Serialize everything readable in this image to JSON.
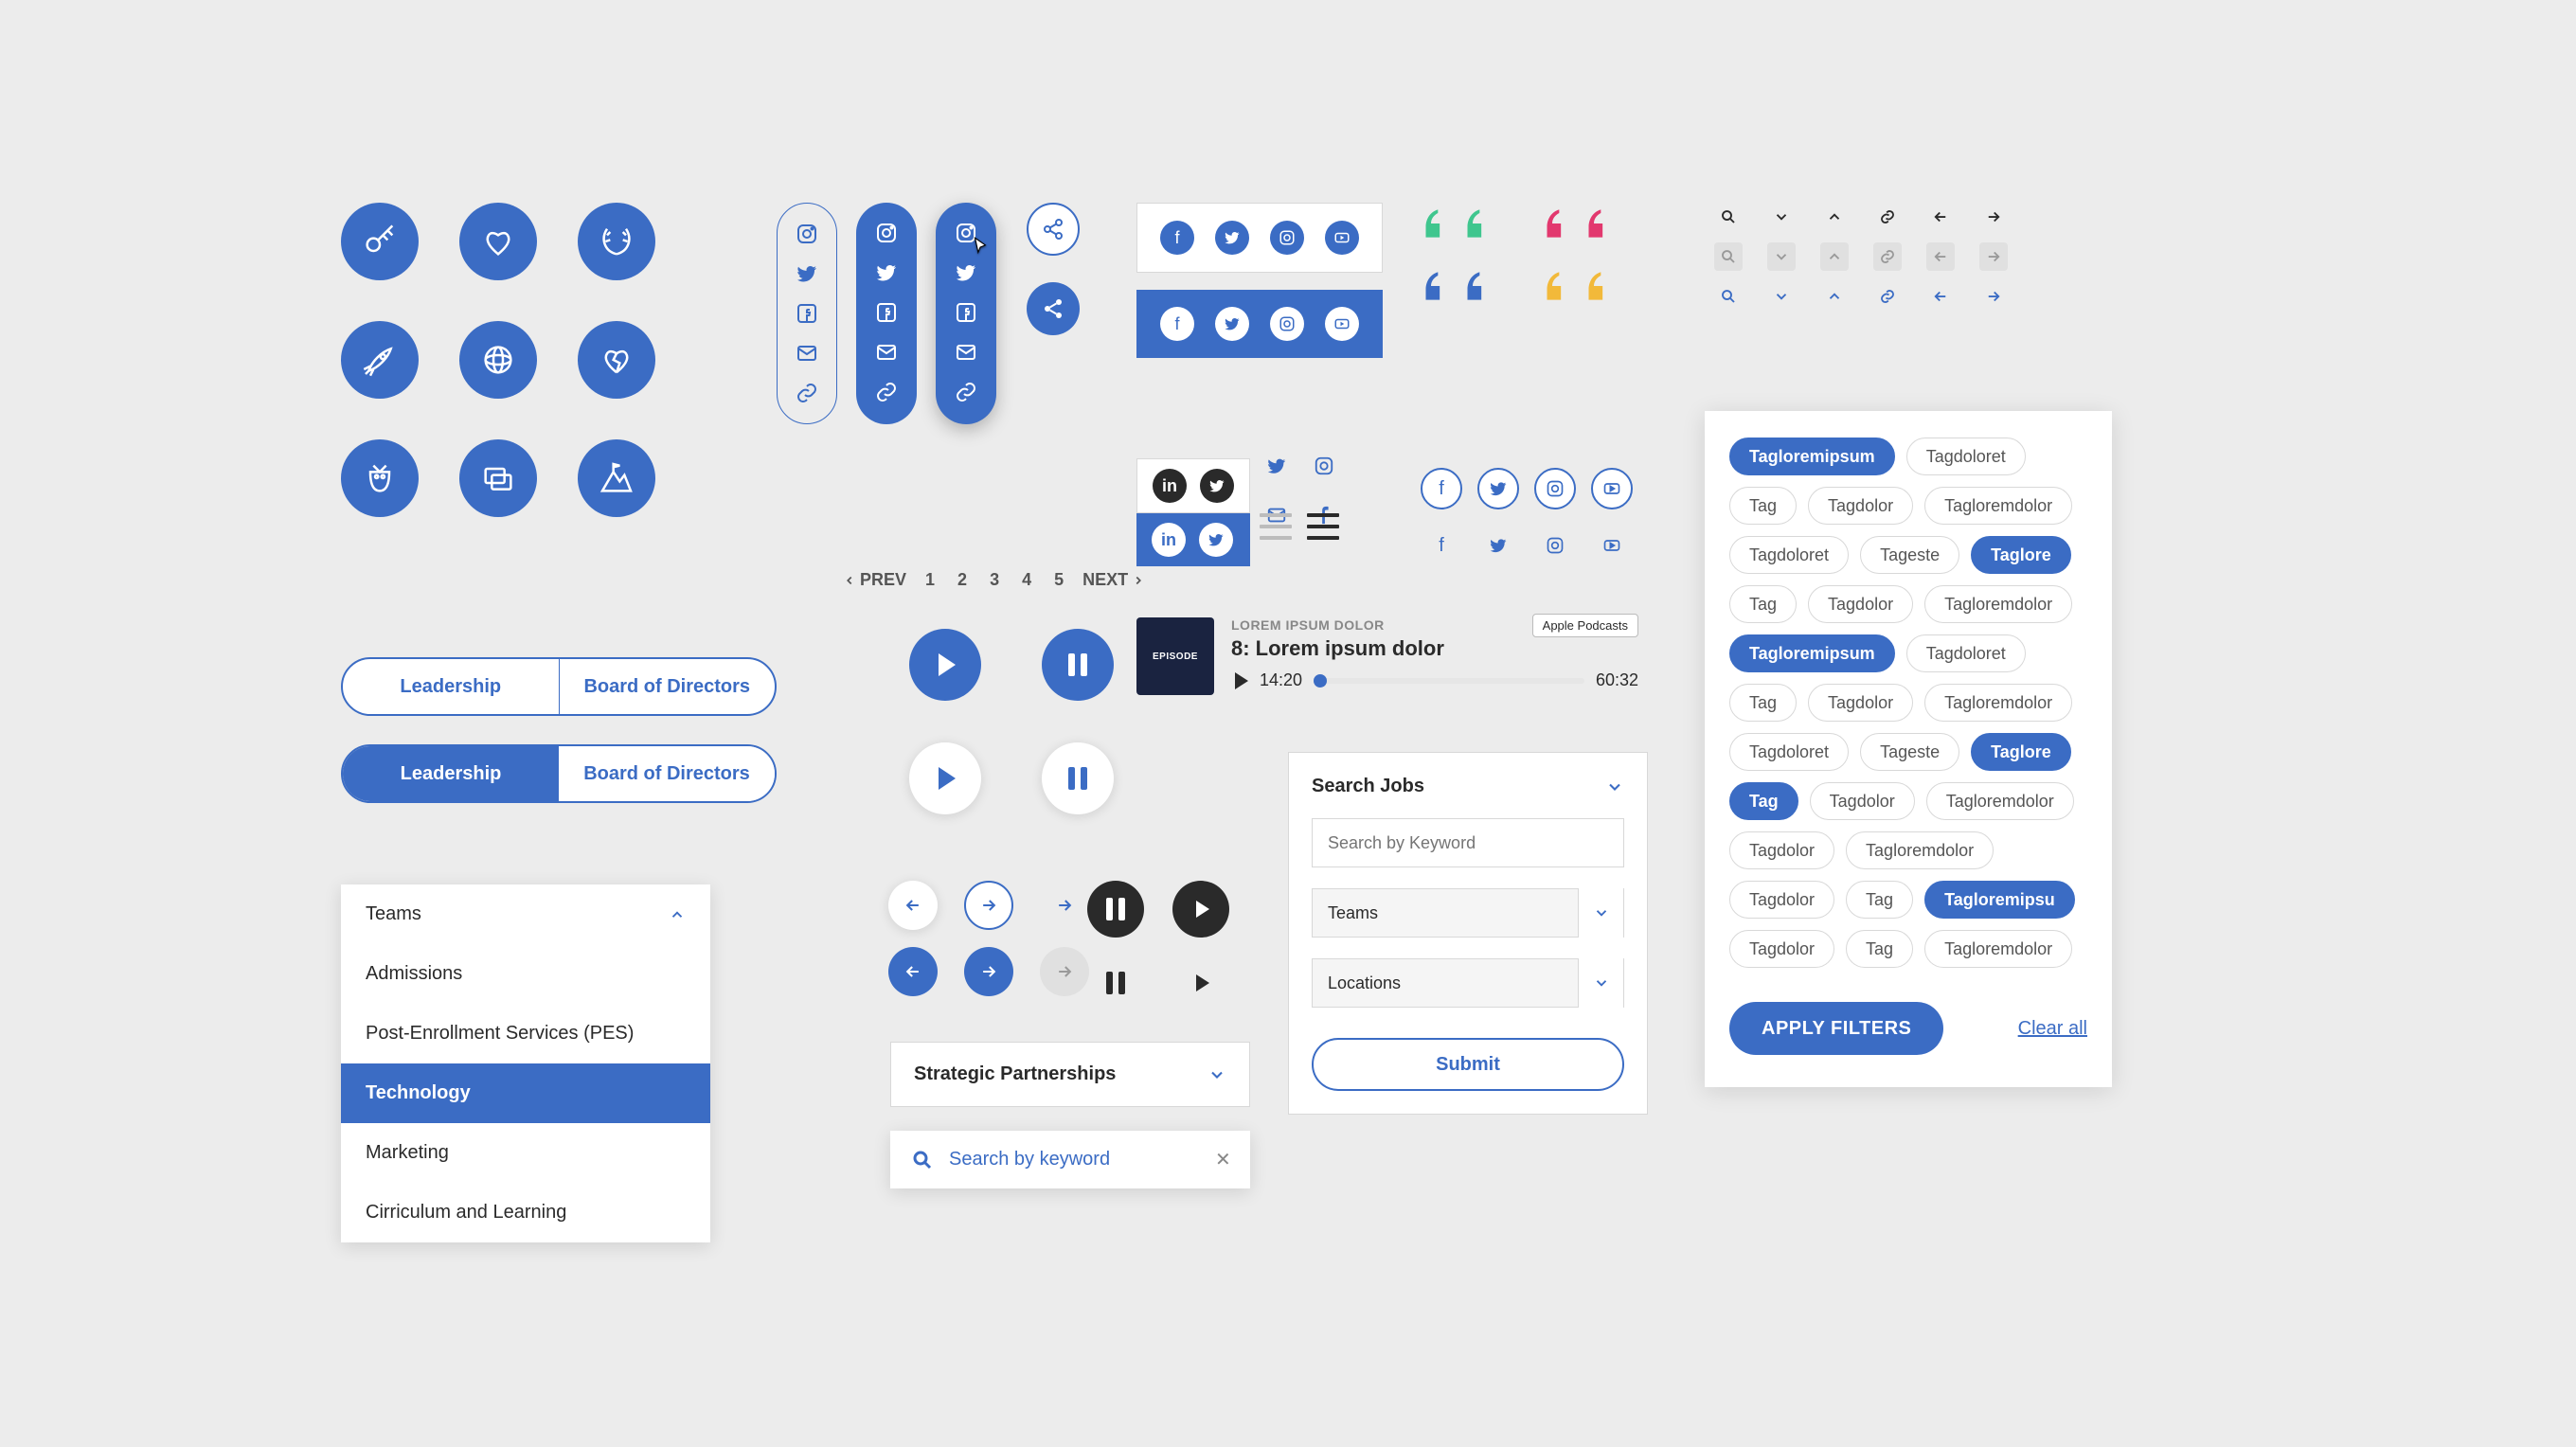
{
  "colors": {
    "primary": "#3b6cc4",
    "green": "#3fc68e",
    "pink": "#e2386e",
    "yellow": "#f2b93a"
  },
  "feature_icons": [
    "key",
    "heart-hands",
    "laurel",
    "rocket",
    "globe",
    "broken-heart",
    "owl",
    "chat-layers",
    "mountain-flag"
  ],
  "social_pills": {
    "variants": [
      "outline",
      "solid",
      "shadow"
    ],
    "items": [
      "instagram",
      "twitter",
      "facebook",
      "mail",
      "link"
    ]
  },
  "share_buttons": [
    "share-outline",
    "share-solid"
  ],
  "social_bars": {
    "items": [
      "facebook",
      "twitter",
      "instagram",
      "youtube"
    ]
  },
  "linkedin_twitter_block": {
    "rows": [
      {
        "style": "outline",
        "items": [
          "linkedin",
          "twitter"
        ]
      },
      {
        "style": "filled",
        "items": [
          "linkedin",
          "twitter"
        ]
      }
    ]
  },
  "hamburger_variants": [
    "grey",
    "dark"
  ],
  "social_small_grid": {
    "rows": [
      [
        "twitter",
        "instagram"
      ],
      [
        "mail",
        "facebook"
      ]
    ]
  },
  "social_circle_grid": {
    "rows": [
      {
        "style": "outline",
        "items": [
          "facebook",
          "twitter",
          "instagram",
          "youtube"
        ]
      },
      {
        "style": "plain",
        "items": [
          "facebook",
          "twitter",
          "instagram",
          "youtube"
        ]
      }
    ]
  },
  "quote_colors": [
    "green",
    "pink",
    "blue",
    "yellow"
  ],
  "nav_icon_rows": {
    "variants": [
      "plain",
      "grey",
      "blue"
    ],
    "items": [
      "search",
      "chevron-down",
      "chevron-up",
      "link",
      "arrow-left",
      "arrow-right"
    ]
  },
  "segmented": {
    "left": "Leadership",
    "right": "Board of Directors"
  },
  "media_controls": {
    "row1": [
      "play-solid",
      "pause-solid"
    ],
    "row2": [
      "play-white",
      "pause-white"
    ]
  },
  "arrow_cluster": [
    {
      "kind": "arrow-left",
      "style": "white"
    },
    {
      "kind": "arrow-right",
      "style": "outline"
    },
    {
      "kind": "arrow-right",
      "style": "plain"
    },
    {
      "kind": "",
      "style": "hidden"
    },
    {
      "kind": "arrow-left",
      "style": "solid"
    },
    {
      "kind": "arrow-right",
      "style": "solid"
    },
    {
      "kind": "arrow-right",
      "style": "grey"
    }
  ],
  "arrow_cluster_dark": {
    "row1": [
      "pause-dark",
      "play-dark"
    ],
    "row2": [
      "pause-plain",
      "play-plain"
    ]
  },
  "pagination": {
    "prev": "PREV",
    "next": "NEXT",
    "pages": [
      "1",
      "2",
      "3",
      "4",
      "5"
    ]
  },
  "podcast": {
    "art_label": "EPISODE",
    "eyebrow": "LOREM IPSUM DOLOR",
    "title": "8: Lorem ipsum dolor",
    "current": "14:20",
    "total": "60:32",
    "provider_badge": "Apple Podcasts"
  },
  "accordion": {
    "items": [
      {
        "label": "Teams",
        "expanded": true
      },
      {
        "label": "Admissions"
      },
      {
        "label": "Post-Enrollment Services (PES)"
      },
      {
        "label": "Technology",
        "active": true
      },
      {
        "label": "Marketing"
      },
      {
        "label": "Cirriculum and Learning"
      }
    ]
  },
  "accordion_single": {
    "label": "Strategic Partnerships"
  },
  "search_box": {
    "placeholder": "Search by keyword"
  },
  "jobs_panel": {
    "title": "Search Jobs",
    "keyword_placeholder": "Search by Keyword",
    "select_teams": "Teams",
    "select_locations": "Locations",
    "submit": "Submit"
  },
  "tags_panel": {
    "tags": [
      {
        "label": "Tagloremipsum",
        "on": true
      },
      {
        "label": "Tagdoloret"
      },
      {
        "label": "Tag"
      },
      {
        "label": "Tagdolor"
      },
      {
        "label": "Tagloremdolor"
      },
      {
        "label": "Tagdoloret"
      },
      {
        "label": "Tageste"
      },
      {
        "label": "Taglore",
        "on": true
      },
      {
        "label": "Tag"
      },
      {
        "label": "Tagdolor"
      },
      {
        "label": "Tagloremdolor"
      },
      {
        "label": "Tagloremipsum",
        "on": true
      },
      {
        "label": "Tagdoloret"
      },
      {
        "label": "Tag"
      },
      {
        "label": "Tagdolor"
      },
      {
        "label": "Tagloremdolor"
      },
      {
        "label": "Tagdoloret"
      },
      {
        "label": "Tageste"
      },
      {
        "label": "Taglore",
        "on": true
      },
      {
        "label": "Tag",
        "on": true
      },
      {
        "label": "Tagdolor"
      },
      {
        "label": "Tagloremdolor"
      },
      {
        "label": "Tagdolor"
      },
      {
        "label": "Tagloremdolor"
      },
      {
        "label": "Tagdolor"
      },
      {
        "label": "Tag"
      },
      {
        "label": "Tagloremipsu",
        "on": true
      },
      {
        "label": "Tagdolor"
      },
      {
        "label": "Tag"
      },
      {
        "label": "Tagloremdolor"
      }
    ],
    "apply": "APPLY FILTERS",
    "clear": "Clear all"
  }
}
